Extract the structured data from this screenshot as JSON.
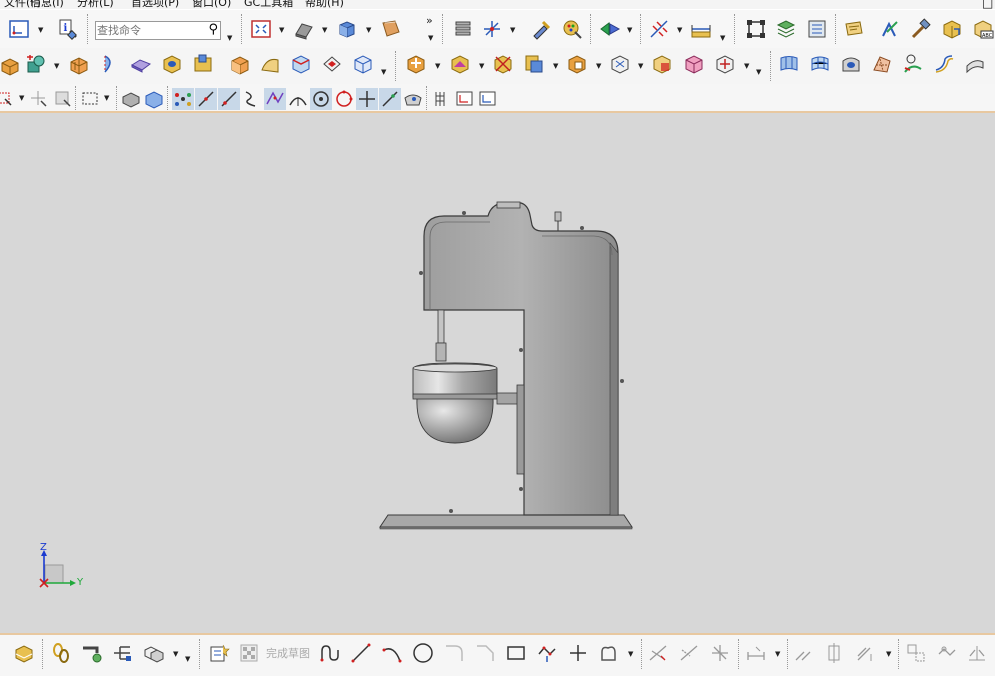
{
  "menu": {
    "items": [
      "文件(F)",
      "信息(I)",
      "分析(L)",
      "首选项(P)",
      "窗口(O)",
      "GC工具箱",
      "帮助(H)"
    ],
    "window_controls": [
      "_",
      "□"
    ]
  },
  "toolbar1": {
    "search_placeholder": "查找命令",
    "overflow_label": "»"
  },
  "bottom_toolbar": {
    "finish_sketch_label": "完成草图"
  },
  "triad": {
    "z_label": "Z",
    "y_label": "Y",
    "z_color": "#1a3ad0",
    "y_color": "#1fa83a",
    "x_color": "#d02020"
  },
  "colors": {
    "viewport_bg": "#d7d7d7",
    "model_fill": "#a8a8a8",
    "model_edge": "#3a3a3a",
    "accent_border": "#e8c8a0"
  },
  "model": {
    "name": "mixer-stand-assembly"
  }
}
